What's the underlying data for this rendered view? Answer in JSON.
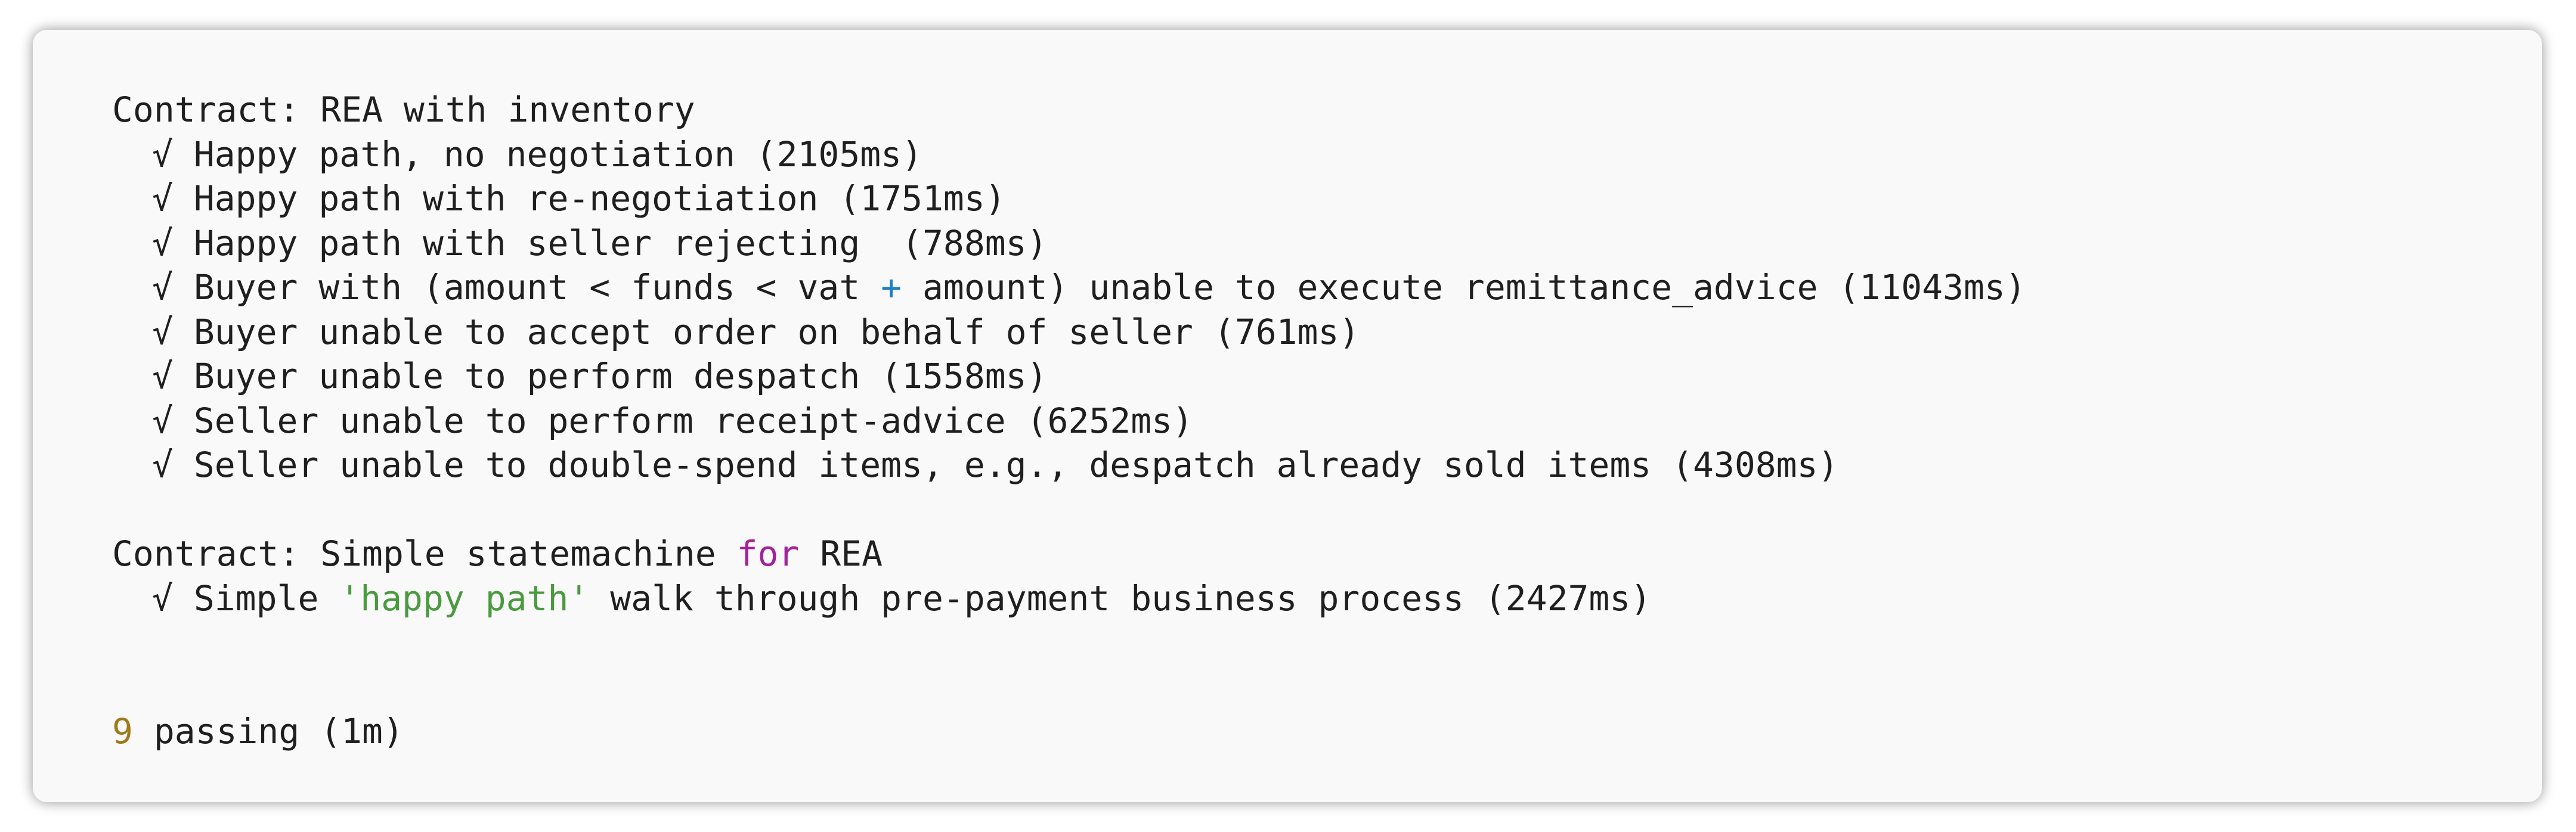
{
  "suites": [
    {
      "title": "Contract: REA with inventory",
      "tests": [
        {
          "check": "√",
          "text": "Happy path, no negotiation (2105ms)"
        },
        {
          "check": "√",
          "text": "Happy path with re-negotiation (1751ms)"
        },
        {
          "check": "√",
          "text": "Happy path with seller rejecting  (788ms)"
        },
        {
          "check": "√",
          "pre": "Buyer with (amount < funds < vat ",
          "op": "+",
          "post": " amount) unable to execute remittance_advice (11043ms)"
        },
        {
          "check": "√",
          "text": "Buyer unable to accept order on behalf of seller (761ms)"
        },
        {
          "check": "√",
          "text": "Buyer unable to perform despatch (1558ms)"
        },
        {
          "check": "√",
          "text": "Seller unable to perform receipt-advice (6252ms)"
        },
        {
          "check": "√",
          "text": "Seller unable to double-spend items, e.g., despatch already sold items (4308ms)"
        }
      ]
    },
    {
      "title_pre": "Contract: Simple statemachine ",
      "title_kw": "for",
      "title_post": " REA",
      "tests": [
        {
          "check": "√",
          "pre": "Simple ",
          "str": "'happy path'",
          "post": " walk through pre-payment business process (2427ms)"
        }
      ]
    }
  ],
  "summary": {
    "count": "9",
    "text": " passing (1m)"
  },
  "colors": {
    "operator": "#1f7fc4",
    "keyword": "#a3229c",
    "string": "#4a9a3f",
    "number": "#a07a1a"
  }
}
